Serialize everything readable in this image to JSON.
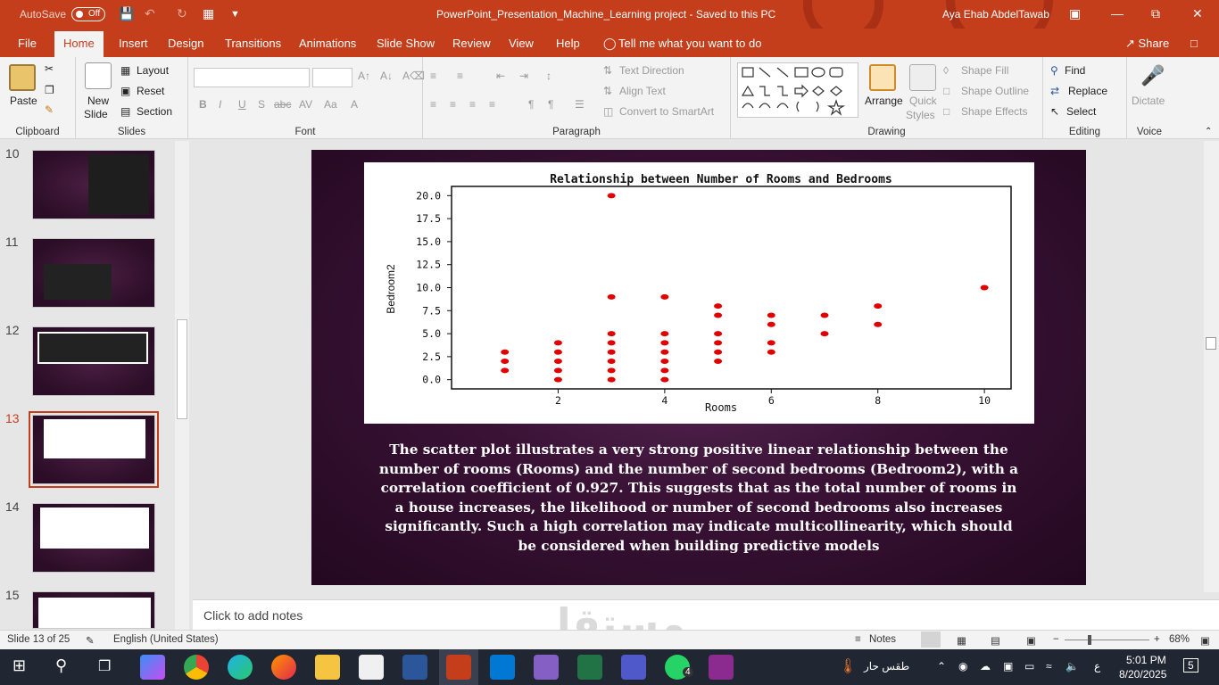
{
  "titlebar": {
    "autosave_label": "AutoSave",
    "autosave_state": "Off",
    "doc_title": "PowerPoint_Presentation_Machine_Learning project  -  Saved to this PC",
    "user": "Aya Ehab AbdelTawab"
  },
  "menu": {
    "tabs": [
      "File",
      "Home",
      "Insert",
      "Design",
      "Transitions",
      "Animations",
      "Slide Show",
      "Review",
      "View",
      "Help"
    ],
    "active": "Home",
    "tell_me": "Tell me what you want to do",
    "share": "Share"
  },
  "ribbon": {
    "clipboard": {
      "label": "Clipboard",
      "paste": "Paste"
    },
    "slides": {
      "label": "Slides",
      "new_slide_1": "New",
      "new_slide_2": "Slide",
      "layout": "Layout",
      "reset": "Reset",
      "section": "Section"
    },
    "font": {
      "label": "Font",
      "bold": "B",
      "italic": "I",
      "underline": "U",
      "strike": "S",
      "abc": "abc",
      "spacing": "AV",
      "case": "Aa",
      "color": "A"
    },
    "paragraph": {
      "label": "Paragraph",
      "text_direction": "Text Direction",
      "align_text": "Align Text",
      "convert_smartart": "Convert to SmartArt"
    },
    "drawing": {
      "label": "Drawing",
      "arrange": "Arrange",
      "quick_styles_1": "Quick",
      "quick_styles_2": "Styles",
      "shape_fill": "Shape Fill",
      "shape_outline": "Shape Outline",
      "shape_effects": "Shape Effects"
    },
    "editing": {
      "label": "Editing",
      "find": "Find",
      "replace": "Replace",
      "select": "Select"
    },
    "voice": {
      "label": "Voice",
      "dictate": "Dictate"
    }
  },
  "thumbnails": [
    {
      "num": "10"
    },
    {
      "num": "11"
    },
    {
      "num": "12"
    },
    {
      "num": "13"
    },
    {
      "num": "14"
    },
    {
      "num": "15"
    }
  ],
  "active_slide": "13",
  "slide": {
    "caption": "The scatter plot illustrates a very strong positive linear relationship between the number of rooms (Rooms) and the number of second bedrooms (Bedroom2), with a correlation coefficient of 0.927. This suggests that as the total number of rooms in a house increases, the likelihood or number of second bedrooms also increases significantly. Such a high correlation may indicate multicollinearity, which should be considered when building predictive models"
  },
  "chart_data": {
    "type": "scatter",
    "title": "Relationship between Number of Rooms and Bedrooms",
    "xlabel": "Rooms",
    "ylabel": "Bedroom2",
    "xlim": [
      0,
      10.5
    ],
    "ylim": [
      -1,
      21
    ],
    "x_ticks": [
      2,
      4,
      6,
      8,
      10
    ],
    "y_ticks": [
      0.0,
      2.5,
      5.0,
      7.5,
      10.0,
      12.5,
      15.0,
      17.5,
      20.0
    ],
    "y_tick_labels": [
      "0.0",
      "2.5",
      "5.0",
      "7.5",
      "10.0",
      "12.5",
      "15.0",
      "17.5",
      "20.0"
    ],
    "point_color": "#e00000",
    "points": [
      [
        1,
        1
      ],
      [
        1,
        2
      ],
      [
        1,
        3
      ],
      [
        2,
        0
      ],
      [
        2,
        1
      ],
      [
        2,
        2
      ],
      [
        2,
        3
      ],
      [
        2,
        4
      ],
      [
        3,
        0
      ],
      [
        3,
        1
      ],
      [
        3,
        2
      ],
      [
        3,
        3
      ],
      [
        3,
        4
      ],
      [
        3,
        5
      ],
      [
        3,
        9
      ],
      [
        3,
        20
      ],
      [
        4,
        0
      ],
      [
        4,
        1
      ],
      [
        4,
        2
      ],
      [
        4,
        3
      ],
      [
        4,
        4
      ],
      [
        4,
        5
      ],
      [
        4,
        9
      ],
      [
        5,
        2
      ],
      [
        5,
        3
      ],
      [
        5,
        4
      ],
      [
        5,
        5
      ],
      [
        5,
        7
      ],
      [
        5,
        8
      ],
      [
        6,
        3
      ],
      [
        6,
        4
      ],
      [
        6,
        6
      ],
      [
        6,
        7
      ],
      [
        7,
        5
      ],
      [
        7,
        7
      ],
      [
        8,
        6
      ],
      [
        8,
        8
      ],
      [
        10,
        10
      ]
    ]
  },
  "notes": {
    "placeholder": "Click to add notes"
  },
  "status": {
    "slide_info": "Slide 13 of 25",
    "language": "English (United States)",
    "notes_btn": "Notes",
    "zoom": "68%"
  },
  "taskbar": {
    "weather": "طقس حار",
    "time": "5:01 PM",
    "date": "8/20/2025",
    "lang": "ع",
    "notif": "5",
    "whatsapp_badge": "4"
  },
  "watermark": "مستقل"
}
